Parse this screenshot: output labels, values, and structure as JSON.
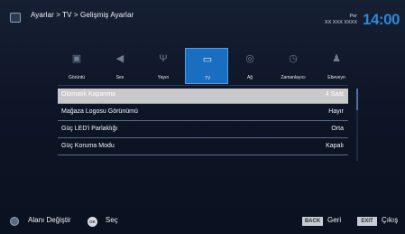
{
  "header": {
    "breadcrumb": "Ayarlar > TV > Gelişmiş Ayarlar",
    "day": "Per",
    "date": "XX XXX XXXX",
    "time": "14:00"
  },
  "categories": [
    {
      "label": "Görüntü",
      "icon": "picture-icon"
    },
    {
      "label": "Ses",
      "icon": "speaker-icon"
    },
    {
      "label": "Yayın",
      "icon": "antenna-icon"
    },
    {
      "label": "TV",
      "icon": "tv-icon"
    },
    {
      "label": "Ağ",
      "icon": "network-icon"
    },
    {
      "label": "Zamanlayıcı",
      "icon": "timer-icon"
    },
    {
      "label": "Ebeveyn",
      "icon": "parental-icon"
    }
  ],
  "active_category": "TV",
  "menu": [
    {
      "name": "Otomatik Kapanma",
      "value": "4 Saat"
    },
    {
      "name": "Mağaza Logosu Görünümü",
      "value": "Hayır"
    },
    {
      "name": "Güç LED'i Parlaklığı",
      "value": "Orta"
    },
    {
      "name": "Güç Koruma Modu",
      "value": "Kapalı"
    }
  ],
  "footer": {
    "move_label": "Alanı Değiştir",
    "ok_key": "OK",
    "ok_label": "Seç",
    "back_key": "BACK",
    "back_label": "Geri",
    "exit_key": "EXIT",
    "exit_label": "Çıkış"
  },
  "colors": {
    "accent": "#1a6ec0",
    "selected_row": "#c9c9cc",
    "clock": "#2c88d9"
  }
}
